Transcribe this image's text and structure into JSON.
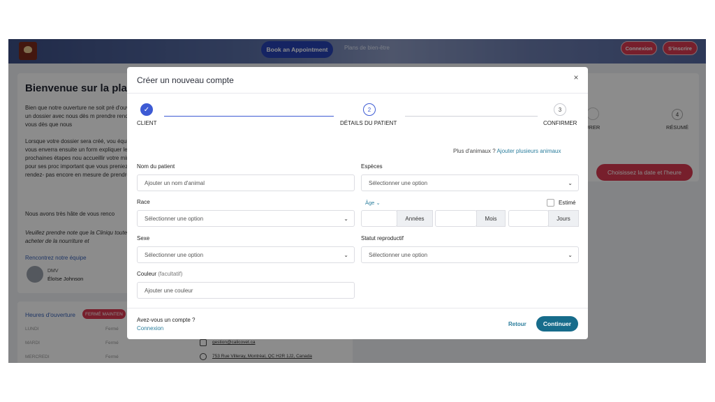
{
  "header": {
    "book_button": "Book an Appointment",
    "plans_link": "Plans de bien-être",
    "login_button": "Connexion",
    "signup_button": "S'inscrire"
  },
  "background": {
    "welcome_title": "Bienvenue sur la platef",
    "paragraphs": [
      "Bien que notre ouverture ne soit pré d'ouvrir un dossier avec nous dès m prendre rendez-vous dès que nous",
      "Lorsque votre dossier sera créé, vou équipe vous enverra ensuite un form expliquer les prochaines étapes nou accueillir votre minou pour ses proc important que vous preniez rendez- pas encore en mesure de prendre e",
      "Nous avons très hâte de vous renco",
      "Veuillez prendre note que la Cliniqu toutefois acheter de la nourriture et"
    ],
    "meet_team": "Rencontrez notre équipe",
    "doctor_title": "DMV",
    "doctor_name": "Éloïse Johnson",
    "hours_title": "Heures d'ouverture",
    "closed_badge": "FERMÉ MAINTEN",
    "days": [
      {
        "day": "LUNDI",
        "status": "Fermé"
      },
      {
        "day": "MARDI",
        "status": "Fermé"
      },
      {
        "day": "MERCREDI",
        "status": "Fermé"
      }
    ],
    "email": "gestion@calicovet.ca",
    "address": "753 Rue Villeray, Montréal, QC H2R 1J2, Canada",
    "step_partial": "URER",
    "step4_number": "4",
    "step4_label": "RÉSUMÉ",
    "choose_button": "Choisissez la date et l'heure"
  },
  "modal": {
    "title": "Créer un nouveau compte",
    "close": "×",
    "steps": [
      {
        "number": "✓",
        "label": "CLIENT"
      },
      {
        "number": "2",
        "label": "DÉTAILS DU PATIENT"
      },
      {
        "number": "3",
        "label": "CONFIRMER"
      }
    ],
    "more_animals_text": "Plus d'animaux ?",
    "more_animals_link": "Ajouter plusieurs animaux",
    "fields": {
      "patient_name_label": "Nom du patient",
      "patient_name_placeholder": "Ajouter un nom d'animal",
      "species_label": "Espèces",
      "species_placeholder": "Sélectionner une option",
      "breed_label": "Race",
      "breed_placeholder": "Sélectionner une option",
      "age_label": "Âge",
      "estimated_label": "Estimé",
      "years_label": "Années",
      "months_label": "Mois",
      "days_label": "Jours",
      "sex_label": "Sexe",
      "sex_placeholder": "Sélectionner une option",
      "repro_label": "Statut reproductif",
      "repro_placeholder": "Sélectionner une option",
      "color_label": "Couleur",
      "color_optional": "(facultatif)",
      "color_placeholder": "Ajouter une couleur"
    },
    "footer": {
      "has_account": "Avez-vous un compte ?",
      "login_link": "Connexion",
      "back": "Retour",
      "continue": "Continuer"
    }
  }
}
